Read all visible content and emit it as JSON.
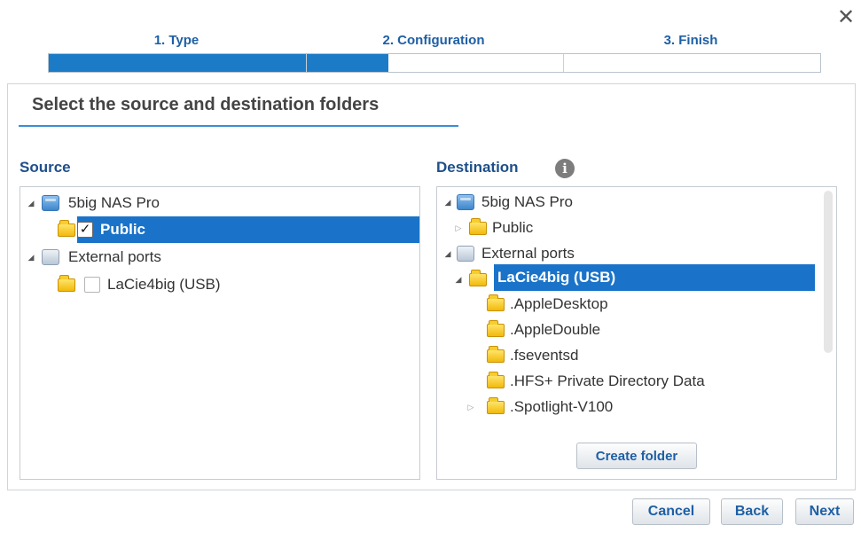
{
  "wizard": {
    "close_glyph": "✕",
    "steps": [
      {
        "label": "1. Type"
      },
      {
        "label": "2. Configuration"
      },
      {
        "label": "3. Finish"
      }
    ],
    "progress_fraction": 0.44
  },
  "panel": {
    "title": "Select the source and destination folders"
  },
  "source": {
    "label": "Source",
    "tree": {
      "nas": {
        "label": "5big NAS Pro",
        "icon": "nas-drive-icon",
        "expanded": true
      },
      "public": {
        "label": "Public",
        "icon": "folder-icon",
        "checked": true,
        "selected": true
      },
      "external": {
        "label": "External ports",
        "icon": "external-drive-icon",
        "expanded": true
      },
      "lacie": {
        "label": "LaCie4big (USB)",
        "icon": "folder-icon",
        "checked": false
      }
    }
  },
  "destination": {
    "label": "Destination",
    "info_glyph": "i",
    "tree": {
      "nas": {
        "label": "5big NAS Pro",
        "icon": "nas-drive-icon",
        "expanded": true
      },
      "public": {
        "label": "Public",
        "icon": "folder-icon",
        "expanded": false
      },
      "external": {
        "label": "External ports",
        "icon": "external-drive-icon",
        "expanded": true
      },
      "lacie": {
        "label": "LaCie4big (USB)",
        "icon": "folder-icon",
        "expanded": true,
        "selected": true
      },
      "children": [
        {
          "label": ".AppleDesktop"
        },
        {
          "label": ".AppleDouble"
        },
        {
          "label": ".fseventsd"
        },
        {
          "label": ".HFS+ Private Directory Data"
        },
        {
          "label": ".Spotlight-V100"
        }
      ]
    },
    "create_folder_label": "Create folder"
  },
  "footer": {
    "cancel_label": "Cancel",
    "back_label": "Back",
    "next_label": "Next"
  },
  "colors": {
    "accent": "#1a73c9",
    "label_blue": "#1e5fa5",
    "folder_yellow": "#f2b90a"
  }
}
